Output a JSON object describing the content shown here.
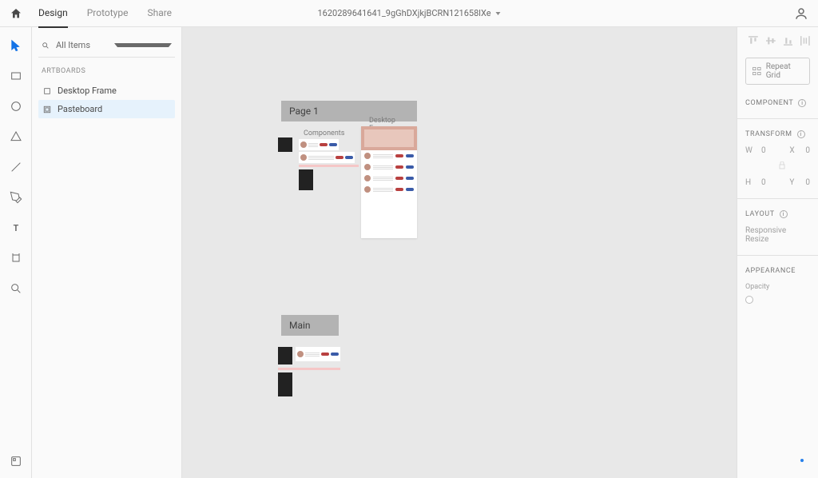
{
  "topbar": {
    "tabs": [
      "Design",
      "Prototype",
      "Share"
    ],
    "document_title": "1620289641641_9gGhDXjkjBCRN121658lXe"
  },
  "layers": {
    "search_placeholder": "All Items",
    "section_label": "ARTBOARDS",
    "items": [
      {
        "label": "Desktop Frame",
        "selected": false
      },
      {
        "label": "Pasteboard",
        "selected": true
      }
    ]
  },
  "canvas": {
    "page1_label": "Page 1",
    "components_label": "Components",
    "artboard_label": "Desktop Frame",
    "main_label": "Main"
  },
  "inspector": {
    "repeat_grid_label": "Repeat Grid",
    "component_label": "COMPONENT",
    "transform_label": "TRANSFORM",
    "transform": {
      "w_label": "W",
      "w_value": "0",
      "x_label": "X",
      "x_value": "0",
      "h_label": "H",
      "h_value": "0",
      "y_label": "Y",
      "y_value": "0"
    },
    "layout_label": "LAYOUT",
    "responsive_label": "Responsive Resize",
    "appearance_label": "APPEARANCE",
    "opacity_label": "Opacity"
  }
}
